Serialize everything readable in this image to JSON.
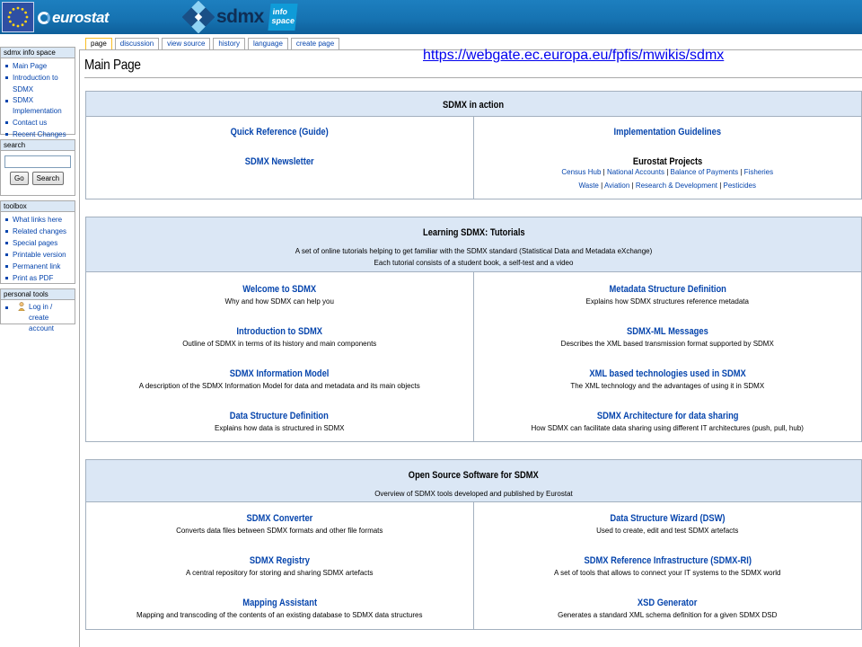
{
  "header": {
    "eurostat_label": "eurostat",
    "sdmx_label": "sdmx",
    "info_space_label": "info space"
  },
  "url": "https://webgate.ec.europa.eu/fpfis/mwikis/sdmx",
  "sidebar": {
    "nav": {
      "title": "sdmx info space",
      "items": [
        "Main Page",
        "Introduction to SDMX",
        "SDMX Implementation",
        "Contact us",
        "Recent Changes"
      ]
    },
    "search": {
      "title": "search",
      "value": "",
      "go_label": "Go",
      "search_label": "Search"
    },
    "toolbox": {
      "title": "toolbox",
      "items": [
        "What links here",
        "Related changes",
        "Special pages",
        "Printable version",
        "Permanent link",
        "Print as PDF"
      ]
    },
    "personal": {
      "title": "personal tools",
      "login_label": "Log in / create account"
    }
  },
  "tabs": [
    {
      "label": "page",
      "selected": true
    },
    {
      "label": "discussion",
      "selected": false
    },
    {
      "label": "view source",
      "selected": false
    },
    {
      "label": "history",
      "selected": false
    },
    {
      "label": "language",
      "selected": false
    },
    {
      "label": "create page",
      "selected": false
    }
  ],
  "page_title": "Main Page",
  "sections": {
    "action": {
      "title": "SDMX in action",
      "left": [
        {
          "title": "Quick Reference (Guide)"
        },
        {
          "title": "SDMX Newsletter"
        }
      ],
      "right": {
        "guidelines": "Implementation Guidelines",
        "projects_title": "Eurostat Projects",
        "projects_line1": [
          "Census Hub",
          "National Accounts",
          "Balance of Payments",
          "Fisheries"
        ],
        "projects_line2": [
          "Waste",
          "Aviation",
          "Research & Development",
          "Pesticides"
        ],
        "separator": " | "
      }
    },
    "learning": {
      "title": "Learning SDMX: Tutorials",
      "subtitle1": "A set of online tutorials helping to get familiar with the SDMX standard (Statistical Data and Metadata eXchange)",
      "subtitle2": "Each tutorial consists of a student book, a self-test and a video",
      "left": [
        {
          "title": "Welcome to SDMX",
          "desc": "Why and how SDMX can help you"
        },
        {
          "title": "Introduction to SDMX",
          "desc": "Outline of SDMX in terms of its history and main components"
        },
        {
          "title": "SDMX Information Model",
          "desc": "A description of the SDMX Information Model for data and metadata and its main objects"
        },
        {
          "title": "Data Structure Definition",
          "desc": "Explains how data is structured in SDMX"
        }
      ],
      "right": [
        {
          "title": "Metadata Structure Definition",
          "desc": "Explains how SDMX structures reference metadata"
        },
        {
          "title": "SDMX-ML Messages",
          "desc": "Describes the XML based transmission format supported by SDMX"
        },
        {
          "title": "XML based technologies used in SDMX",
          "desc": "The XML technology and the advantages of using it in SDMX"
        },
        {
          "title": "SDMX Architecture for data sharing",
          "desc": "How SDMX can facilitate data sharing using different IT architectures (push, pull, hub)"
        }
      ]
    },
    "oss": {
      "title": "Open Source Software for SDMX",
      "subtitle": "Overview of SDMX tools developed and published by Eurostat",
      "left": [
        {
          "title": "SDMX Converter",
          "desc": "Converts data files between SDMX formats and other file formats"
        },
        {
          "title": "SDMX Registry",
          "desc": "A central repository for storing and sharing SDMX artefacts"
        },
        {
          "title": "Mapping Assistant",
          "desc": "Mapping and transcoding of the contents of an existing database to SDMX data structures"
        }
      ],
      "right": [
        {
          "title": "Data Structure Wizard (DSW)",
          "desc": "Used to create, edit and test SDMX artefacts"
        },
        {
          "title": "SDMX Reference Infrastructure (SDMX-RI)",
          "desc": "A set of tools that allows to connect your IT systems to the SDMX world"
        },
        {
          "title": "XSD Generator",
          "desc": "Generates a standard XML schema definition for a given SDMX DSD"
        }
      ]
    }
  },
  "icons": {
    "eu_flag": "eu-flag-icon",
    "sdmx_logo": "sdmx-logo-icon",
    "login": "user-icon"
  },
  "colors": {
    "header_blue": "#1673b2",
    "link_blue": "#0645ad",
    "section_header_bg": "#dbe7f5",
    "url_blue": "#0000ee"
  }
}
